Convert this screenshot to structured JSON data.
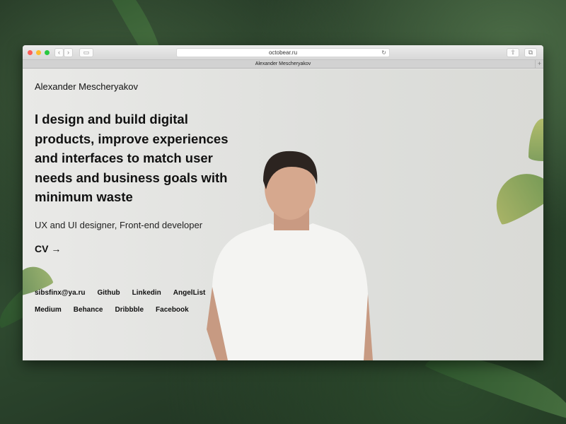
{
  "browser": {
    "url": "octobear.ru",
    "tab_title": "Alexander Mescheryakov",
    "nav_back": "‹",
    "nav_forward": "›",
    "new_tab": "+"
  },
  "page": {
    "name": "Alexander Mescheryakov",
    "headline": "I design and build digital products, improve experiences and interfaces to match user needs and business goals with minimum waste",
    "subtitle": "UX and UI designer, Front-end developer",
    "cv": "CV →",
    "links_row1": [
      "sibsfinx@ya.ru",
      "Github",
      "Linkedin",
      "AngelList"
    ],
    "links_row2": [
      "Medium",
      "Behance",
      "Dribbble",
      "Facebook"
    ]
  }
}
